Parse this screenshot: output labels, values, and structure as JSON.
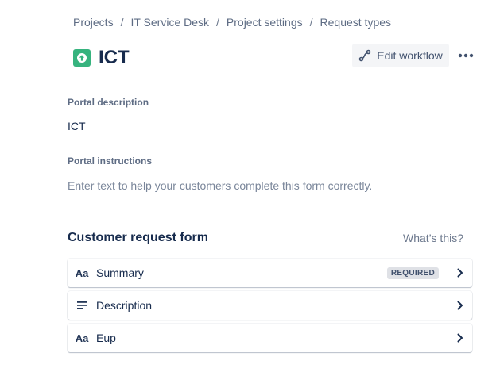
{
  "breadcrumb": [
    "Projects",
    "IT Service Desk",
    "Project settings",
    "Request types"
  ],
  "breadcrumb_separator": "/",
  "header": {
    "icon": "arrow-up-icon",
    "icon_color": "#36b37e",
    "title": "ICT",
    "edit_workflow_label": "Edit workflow",
    "more_icon": "more-horizontal-icon"
  },
  "portal": {
    "description_label": "Portal description",
    "description_value": "ICT",
    "instructions_label": "Portal instructions",
    "instructions_placeholder": "Enter text to help your customers complete this form correctly."
  },
  "form": {
    "title": "Customer request form",
    "help_link": "What’s this?",
    "fields": [
      {
        "icon": "text-field-icon",
        "icon_text": "Aa",
        "label": "Summary",
        "badge": "REQUIRED"
      },
      {
        "icon": "paragraph-icon",
        "label": "Description"
      },
      {
        "icon": "text-field-icon",
        "icon_text": "Aa",
        "label": "Eup"
      }
    ]
  },
  "colors": {
    "text": "#172b4d",
    "subtle": "#5e6c84",
    "accent_green": "#36b37e"
  }
}
